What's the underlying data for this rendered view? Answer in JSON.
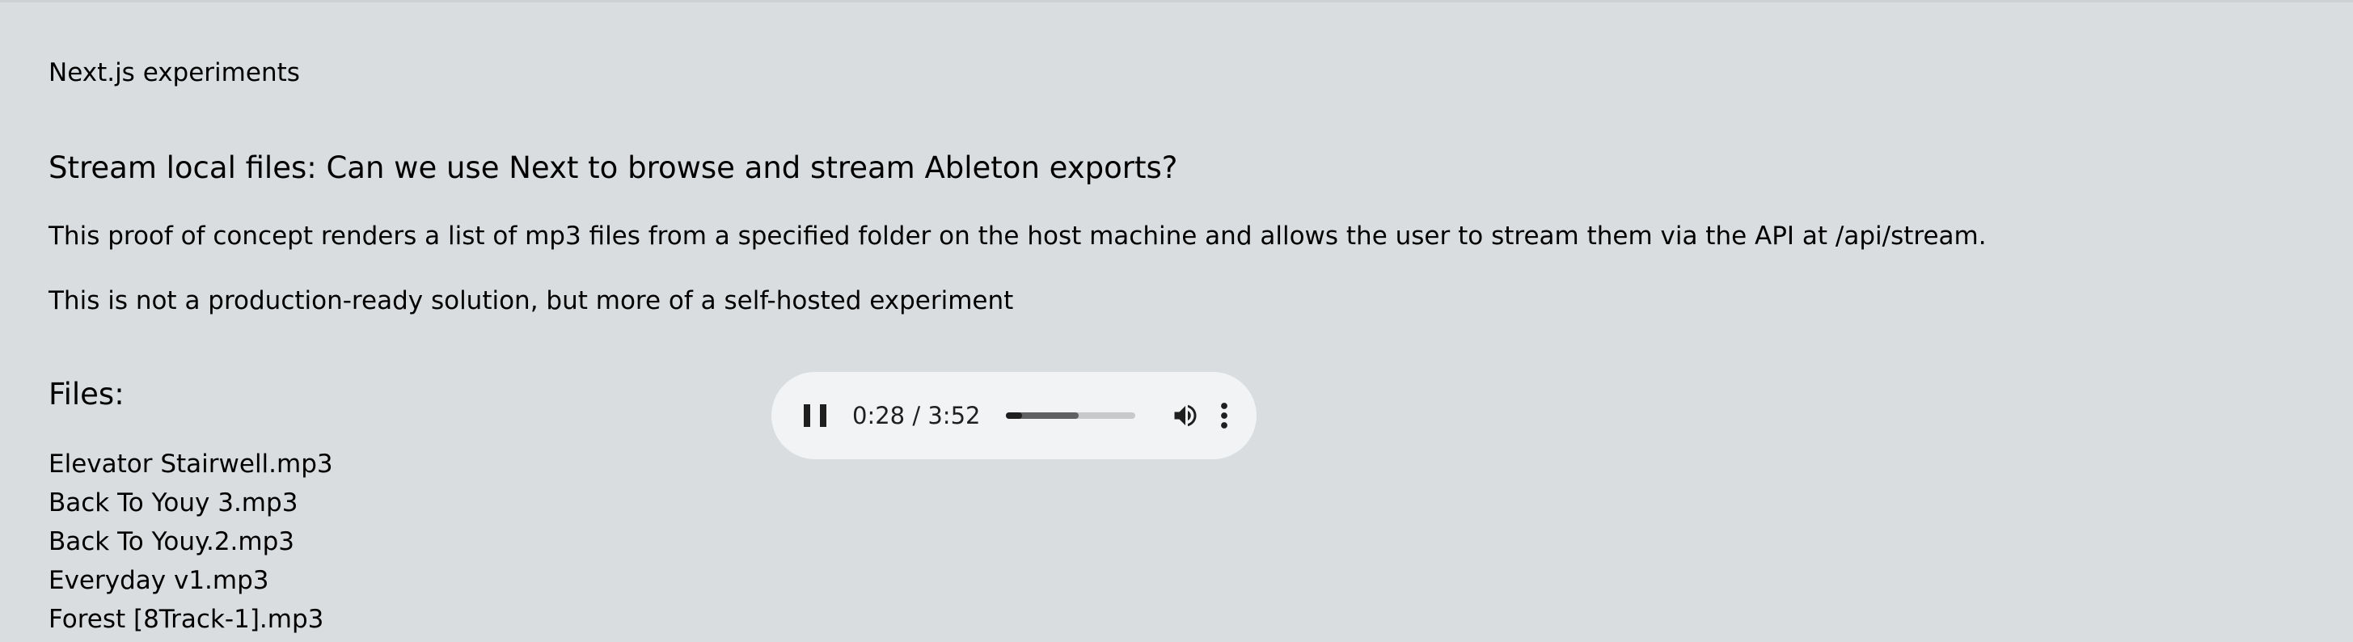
{
  "header": {
    "site_title": "Next.js experiments"
  },
  "main": {
    "heading": "Stream local files: Can we use Next to browse and stream Ableton exports?",
    "paragraphs": [
      "This proof of concept renders a list of mp3 files from a specified folder on the host machine and allows the user to stream them via the API at /api/stream.",
      "This is not a production-ready solution, but more of a self-hosted experiment"
    ],
    "files_heading": "Files:",
    "files": [
      "Elevator Stairwell.mp3",
      "Back To Youy 3.mp3",
      "Back To Youy.2.mp3",
      "Everyday v1.mp3",
      "Forest [8Track-1].mp3"
    ]
  },
  "player": {
    "state": "playing",
    "current_time": "0:28",
    "duration": "3:52",
    "progress_fraction": 0.12,
    "buffered_fraction": 0.56,
    "icons": {
      "play_pause": "pause-icon",
      "volume": "volume-icon",
      "menu": "more-vertical-icon"
    }
  },
  "colors": {
    "page_background": "#d9dddf",
    "player_background": "#f1f3f4",
    "text": "#000000",
    "control": "#1f1f1f"
  }
}
